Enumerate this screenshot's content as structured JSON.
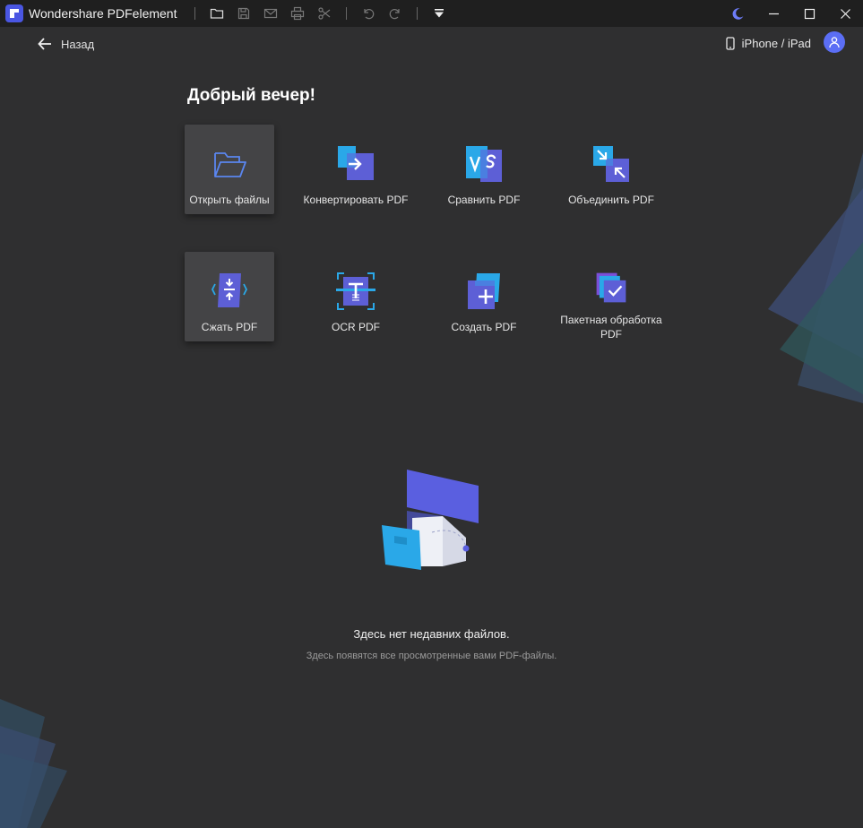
{
  "app": {
    "title": "Wondershare PDFelement"
  },
  "toolbar": {
    "buttons": [
      "folder-icon",
      "save-icon",
      "mail-icon",
      "print-icon",
      "scissors-icon",
      "undo-icon",
      "redo-icon",
      "dropdown-icon"
    ]
  },
  "window": {
    "controls": [
      "moon-icon",
      "minimize-icon",
      "maximize-icon",
      "close-icon"
    ]
  },
  "header": {
    "back_label": "Назад",
    "device_label": "iPhone / iPad"
  },
  "main": {
    "greeting": "Добрый вечер!",
    "tiles": [
      {
        "label": "Открыть файлы",
        "icon": "open-folder-icon"
      },
      {
        "label": "Конвертировать PDF",
        "icon": "convert-icon"
      },
      {
        "label": "Сравнить PDF",
        "icon": "compare-icon"
      },
      {
        "label": "Объединить PDF",
        "icon": "merge-icon"
      },
      {
        "label": "Сжать PDF",
        "icon": "compress-icon"
      },
      {
        "label": "OCR PDF",
        "icon": "ocr-icon"
      },
      {
        "label": "Создать PDF",
        "icon": "create-icon"
      },
      {
        "label": "Пакетная обработка PDF",
        "icon": "batch-icon"
      }
    ]
  },
  "empty_state": {
    "title": "Здесь нет недавних файлов.",
    "subtitle": "Здесь появятся все просмотренные вами PDF-файлы."
  },
  "colors": {
    "background": "#2f2f30",
    "titlebar": "#1f1f1f",
    "accent": "#5b6ef5",
    "tile_active": "#444446"
  }
}
